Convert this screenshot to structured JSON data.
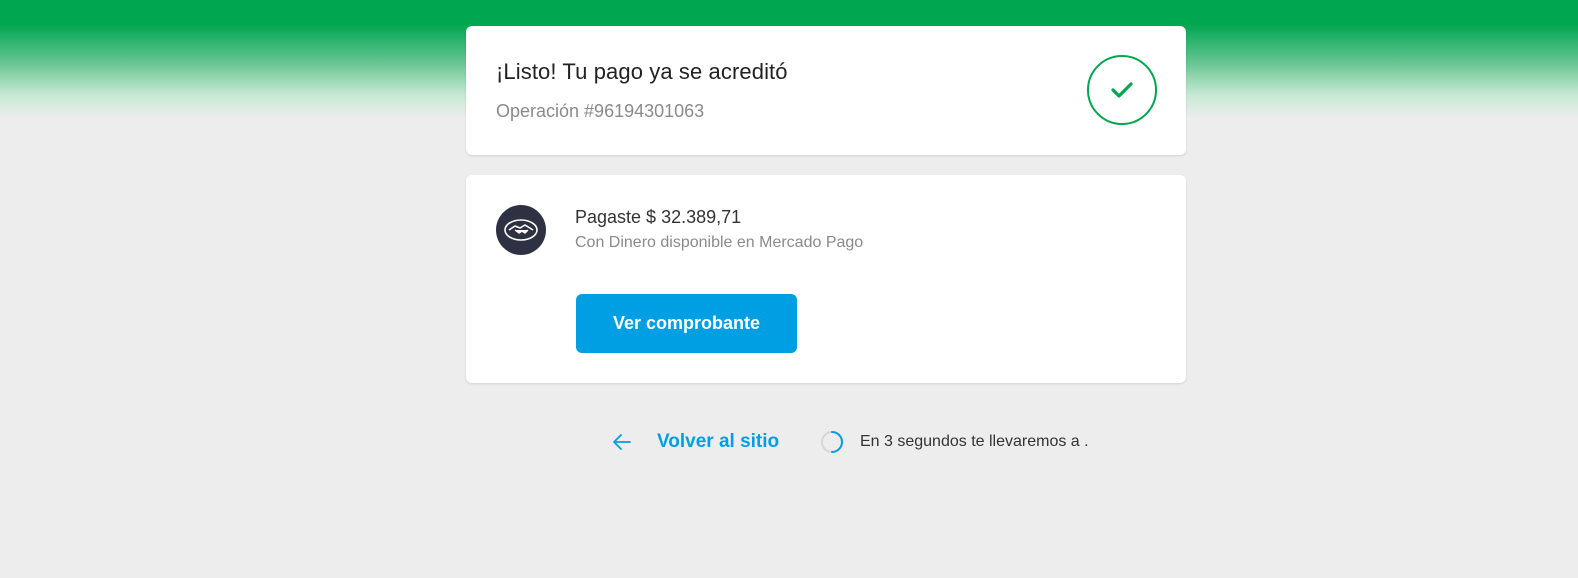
{
  "status": {
    "title": "¡Listo! Tu pago ya se acreditó",
    "operation": "Operación #96194301063",
    "icon": "check-icon",
    "accent_color": "#00a650"
  },
  "payment": {
    "logo_icon": "mercado-pago-handshake-icon",
    "amount_text": "Pagaste $ 32.389,71",
    "method_text": "Con Dinero disponible en Mercado Pago",
    "receipt_button_label": "Ver comprobante",
    "button_color": "#009ee3"
  },
  "footer": {
    "back_icon": "arrow-left-icon",
    "back_label": "Volver al sitio",
    "spinner_icon": "loading-spinner-icon",
    "redirect_text": "En 3 segundos te llevaremos a ."
  }
}
